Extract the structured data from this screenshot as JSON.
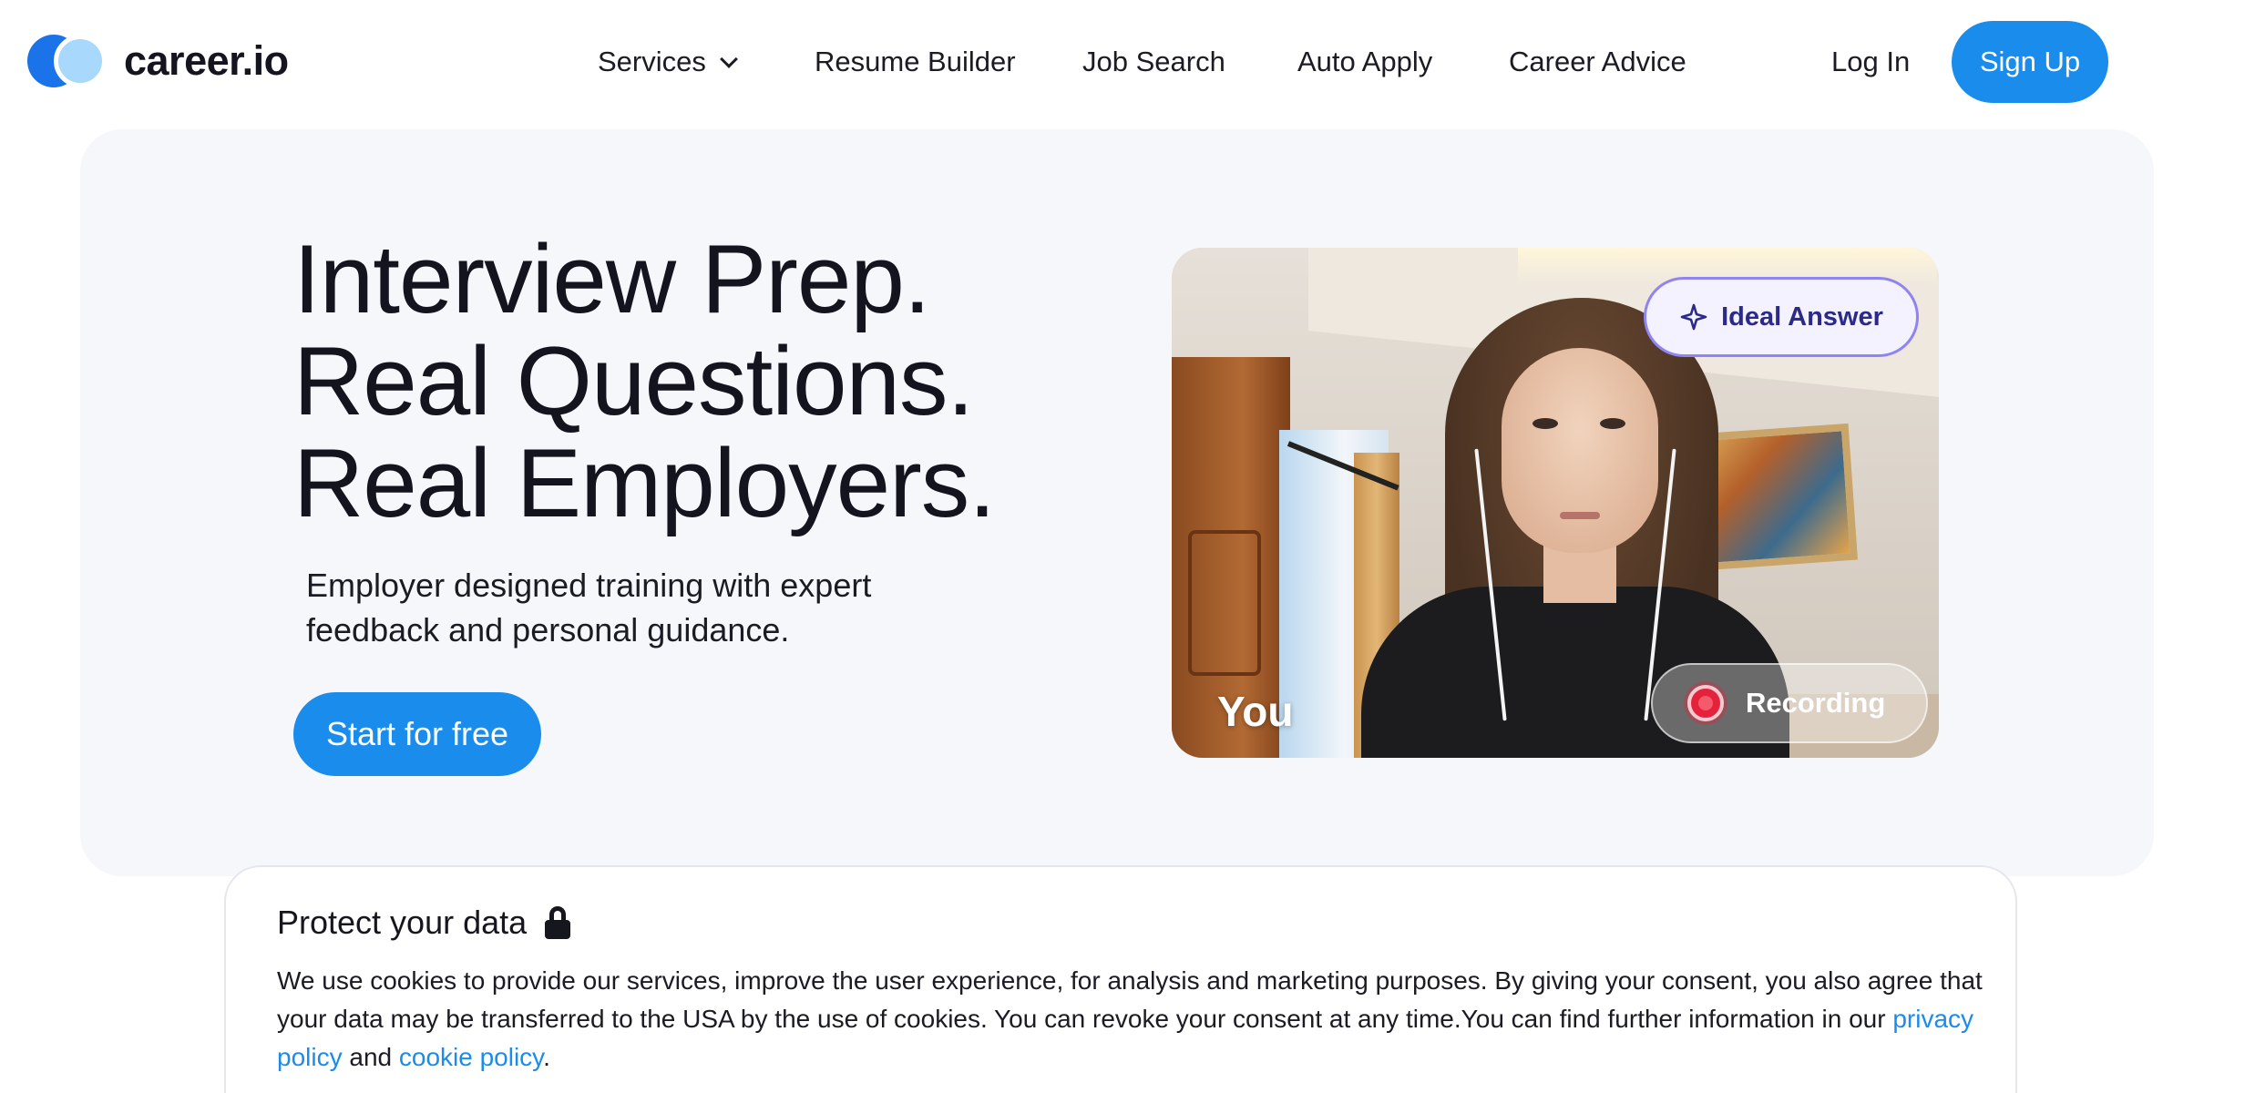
{
  "brand": {
    "name": "career.io",
    "logo_primary": "#1a73e8",
    "logo_secondary": "#a8d8fb"
  },
  "nav": {
    "items": [
      {
        "label": "Services",
        "has_dropdown": true
      },
      {
        "label": "Resume Builder"
      },
      {
        "label": "Job Search"
      },
      {
        "label": "Auto Apply"
      },
      {
        "label": "Career Advice"
      }
    ],
    "login_label": "Log In",
    "signup_label": "Sign Up"
  },
  "hero": {
    "title_lines": [
      "Interview Prep.",
      "Real Questions.",
      "Real Employers."
    ],
    "subtitle": "Employer designed training with expert feedback and personal guidance.",
    "cta_label": "Start for free",
    "video": {
      "ideal_answer_label": "Ideal Answer",
      "ideal_answer_icon": "sparkle-icon",
      "participant_label": "You",
      "recording_label": "Recording",
      "recording_icon": "record-icon"
    }
  },
  "cookie": {
    "title": "Protect your data",
    "title_icon": "lock-icon",
    "body": "We use cookies to provide our services, improve the user experience, for analysis and marketing purposes. By giving your consent, you also agree that your data may be transferred to the USA by the use of cookies. You can revoke your consent at any time.You can find further information in our ",
    "privacy_link": "privacy policy",
    "connector": " and ",
    "cookie_link": "cookie policy",
    "end": "."
  },
  "colors": {
    "accent": "#1a8cec",
    "hero_bg": "#f6f7fb",
    "ideal_border": "#8f84f2",
    "record_red": "#e5223b"
  }
}
